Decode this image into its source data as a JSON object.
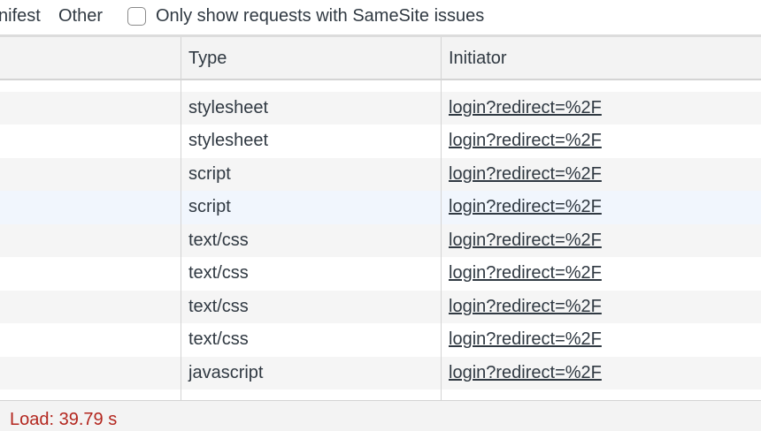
{
  "filter_bar": {
    "manifest_label": "nifest",
    "other_label": "Other",
    "samesite_checkbox_label": "Only show requests with SameSite issues",
    "samesite_checked": false
  },
  "table": {
    "columns": {
      "type": "Type",
      "initiator": "Initiator"
    },
    "rows": [
      {
        "type": "",
        "initiator": ""
      },
      {
        "type": "stylesheet",
        "initiator": "login?redirect=%2F"
      },
      {
        "type": "stylesheet",
        "initiator": "login?redirect=%2F"
      },
      {
        "type": "script",
        "initiator": "login?redirect=%2F"
      },
      {
        "type": "script",
        "initiator": "login?redirect=%2F"
      },
      {
        "type": "text/css",
        "initiator": "login?redirect=%2F"
      },
      {
        "type": "text/css",
        "initiator": "login?redirect=%2F"
      },
      {
        "type": "text/css",
        "initiator": "login?redirect=%2F"
      },
      {
        "type": "text/css",
        "initiator": "login?redirect=%2F"
      },
      {
        "type": "javascript",
        "initiator": "login?redirect=%2F"
      },
      {
        "type": "",
        "initiator": ""
      }
    ]
  },
  "status_bar": {
    "load": "Load: 39.79 s"
  },
  "colors": {
    "load_text": "#b3261e",
    "row_hover": "#f1f6fd"
  }
}
